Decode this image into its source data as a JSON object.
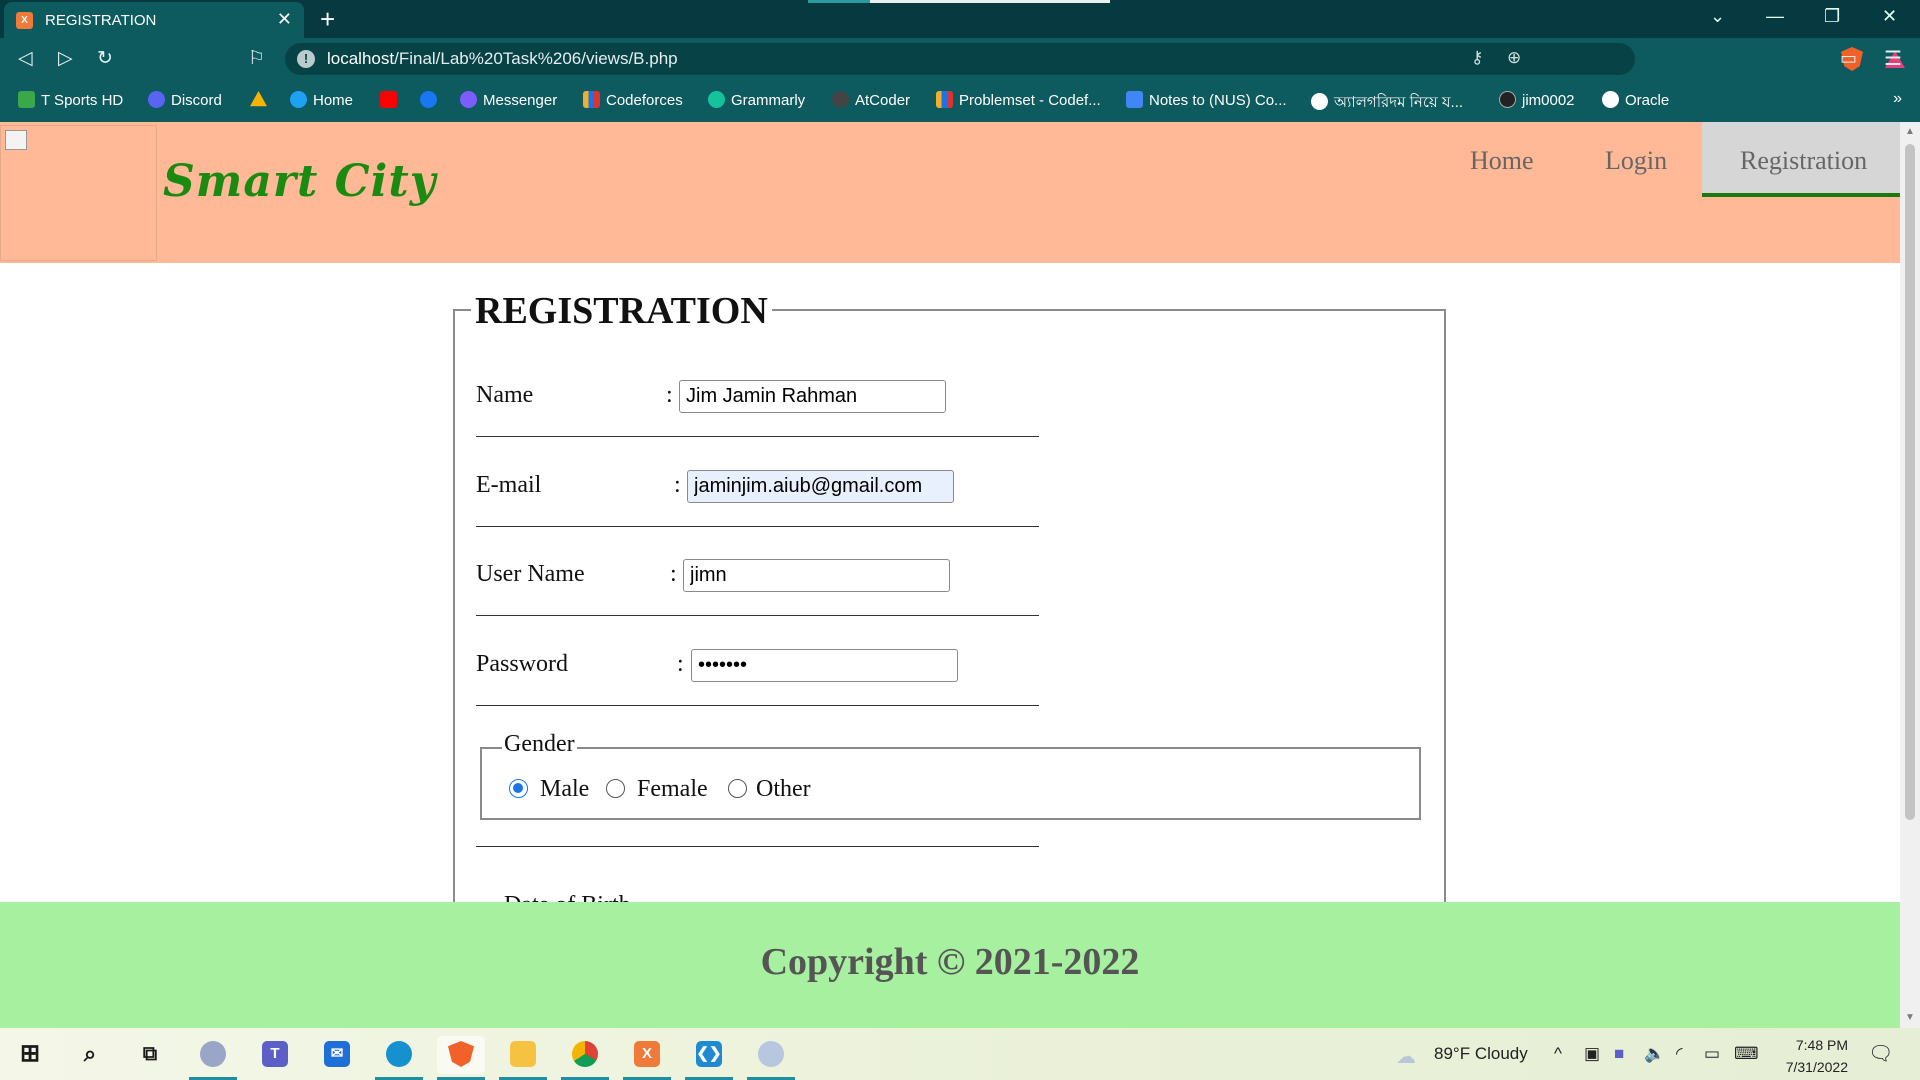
{
  "browser": {
    "tab_title": "REGISTRATION",
    "url_host": "localhost",
    "url_path": "/Final/Lab%20Task%206/views/B.php",
    "bookmarks": [
      {
        "label": "T Sports HD",
        "icon": "tsports-icon",
        "color": "#3aa84a"
      },
      {
        "label": "Discord",
        "icon": "discord-icon",
        "color": "#5865f2"
      },
      {
        "label": "",
        "icon": "google-drive-icon",
        "color": "#f4b400"
      },
      {
        "label": "Home",
        "icon": "twitter-icon",
        "color": "#1da1f2"
      },
      {
        "label": "",
        "icon": "youtube-icon",
        "color": "#ff0000"
      },
      {
        "label": "",
        "icon": "facebook-icon",
        "color": "#1877f2"
      },
      {
        "label": "Messenger",
        "icon": "messenger-icon",
        "color": "#7b5cff"
      },
      {
        "label": "Codeforces",
        "icon": "codeforces-icon",
        "color": "#f2b02a"
      },
      {
        "label": "Grammarly",
        "icon": "grammarly-icon",
        "color": "#15c39a"
      },
      {
        "label": "AtCoder",
        "icon": "atcoder-icon",
        "color": "#444444"
      },
      {
        "label": "Problemset - Codef...",
        "icon": "codeforces-icon",
        "color": "#f2b02a"
      },
      {
        "label": "Notes to (NUS) Co...",
        "icon": "docs-icon",
        "color": "#4285f4"
      },
      {
        "label": "অ্যালগরিদম নিয়ে য...",
        "icon": "globe-icon",
        "color": "#ffffff"
      },
      {
        "label": "jim0002",
        "icon": "github-icon",
        "color": "#222222"
      },
      {
        "label": "Oracle",
        "icon": "globe-icon",
        "color": "#ffffff"
      }
    ]
  },
  "header": {
    "title": "Smart City",
    "nav": {
      "home": "Home",
      "login": "Login",
      "registration": "Registration"
    }
  },
  "form": {
    "legend": "REGISTRATION",
    "name_label": "Name",
    "name_value": "Jim Jamin Rahman",
    "email_label": "E-mail",
    "email_value": "jaminjim.aiub@gmail.com",
    "username_label": "User Name",
    "username_value": "jimn",
    "password_label": "Password",
    "password_value": "•••••••",
    "colon": ":",
    "gender_legend": "Gender",
    "gender_options": [
      "Male",
      "Female",
      "Other"
    ],
    "gender_selected": "Male",
    "dob_legend": "Date of Birth"
  },
  "footer": {
    "copyright": "Copyright © 2021-2022"
  },
  "taskbar": {
    "weather": "89°F  Cloudy",
    "time": "7:48 PM",
    "date": "7/31/2022"
  },
  "colors": {
    "header_bg": "#ffb996",
    "footer_bg": "#a6f0a0",
    "title_green": "#1b8a10",
    "chrome_teal": "#0d5a5f"
  }
}
